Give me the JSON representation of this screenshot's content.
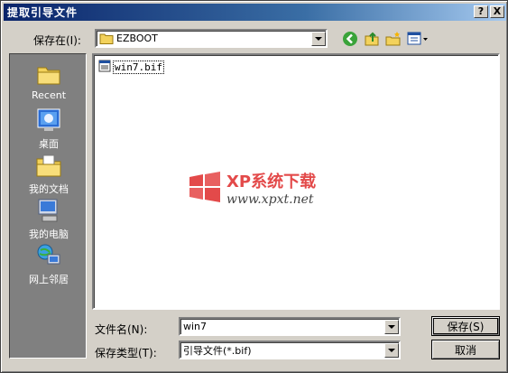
{
  "window": {
    "title": "提取引导文件",
    "help_button": "?",
    "close_button": "X"
  },
  "lookin": {
    "label": "保存在(I):",
    "value": "EZBOOT"
  },
  "toolbar": {
    "back_icon": "back-arrow-icon",
    "up_icon": "up-folder-icon",
    "new_folder_icon": "new-folder-icon",
    "views_icon": "views-menu-icon"
  },
  "places": [
    {
      "label": "Recent",
      "icon": "recent-folder-icon"
    },
    {
      "label": "桌面",
      "icon": "desktop-icon"
    },
    {
      "label": "我的文档",
      "icon": "my-documents-icon"
    },
    {
      "label": "我的电脑",
      "icon": "my-computer-icon"
    },
    {
      "label": "网上邻居",
      "icon": "network-places-icon"
    }
  ],
  "files": [
    {
      "name": "win7.bif",
      "icon": "bif-file-icon"
    }
  ],
  "watermark": {
    "line1": "XP系统下载",
    "line2": "www.xpxt.net"
  },
  "filename": {
    "label": "文件名(N):",
    "value": "win7"
  },
  "filetype": {
    "label": "保存类型(T):",
    "value": "引导文件(*.bif)"
  },
  "buttons": {
    "save": "保存(S)",
    "cancel": "取消"
  },
  "colors": {
    "title_start": "#0a246a",
    "title_end": "#a6caf0",
    "dialog_bg": "#d4d0c8",
    "places_bg": "#808080"
  }
}
